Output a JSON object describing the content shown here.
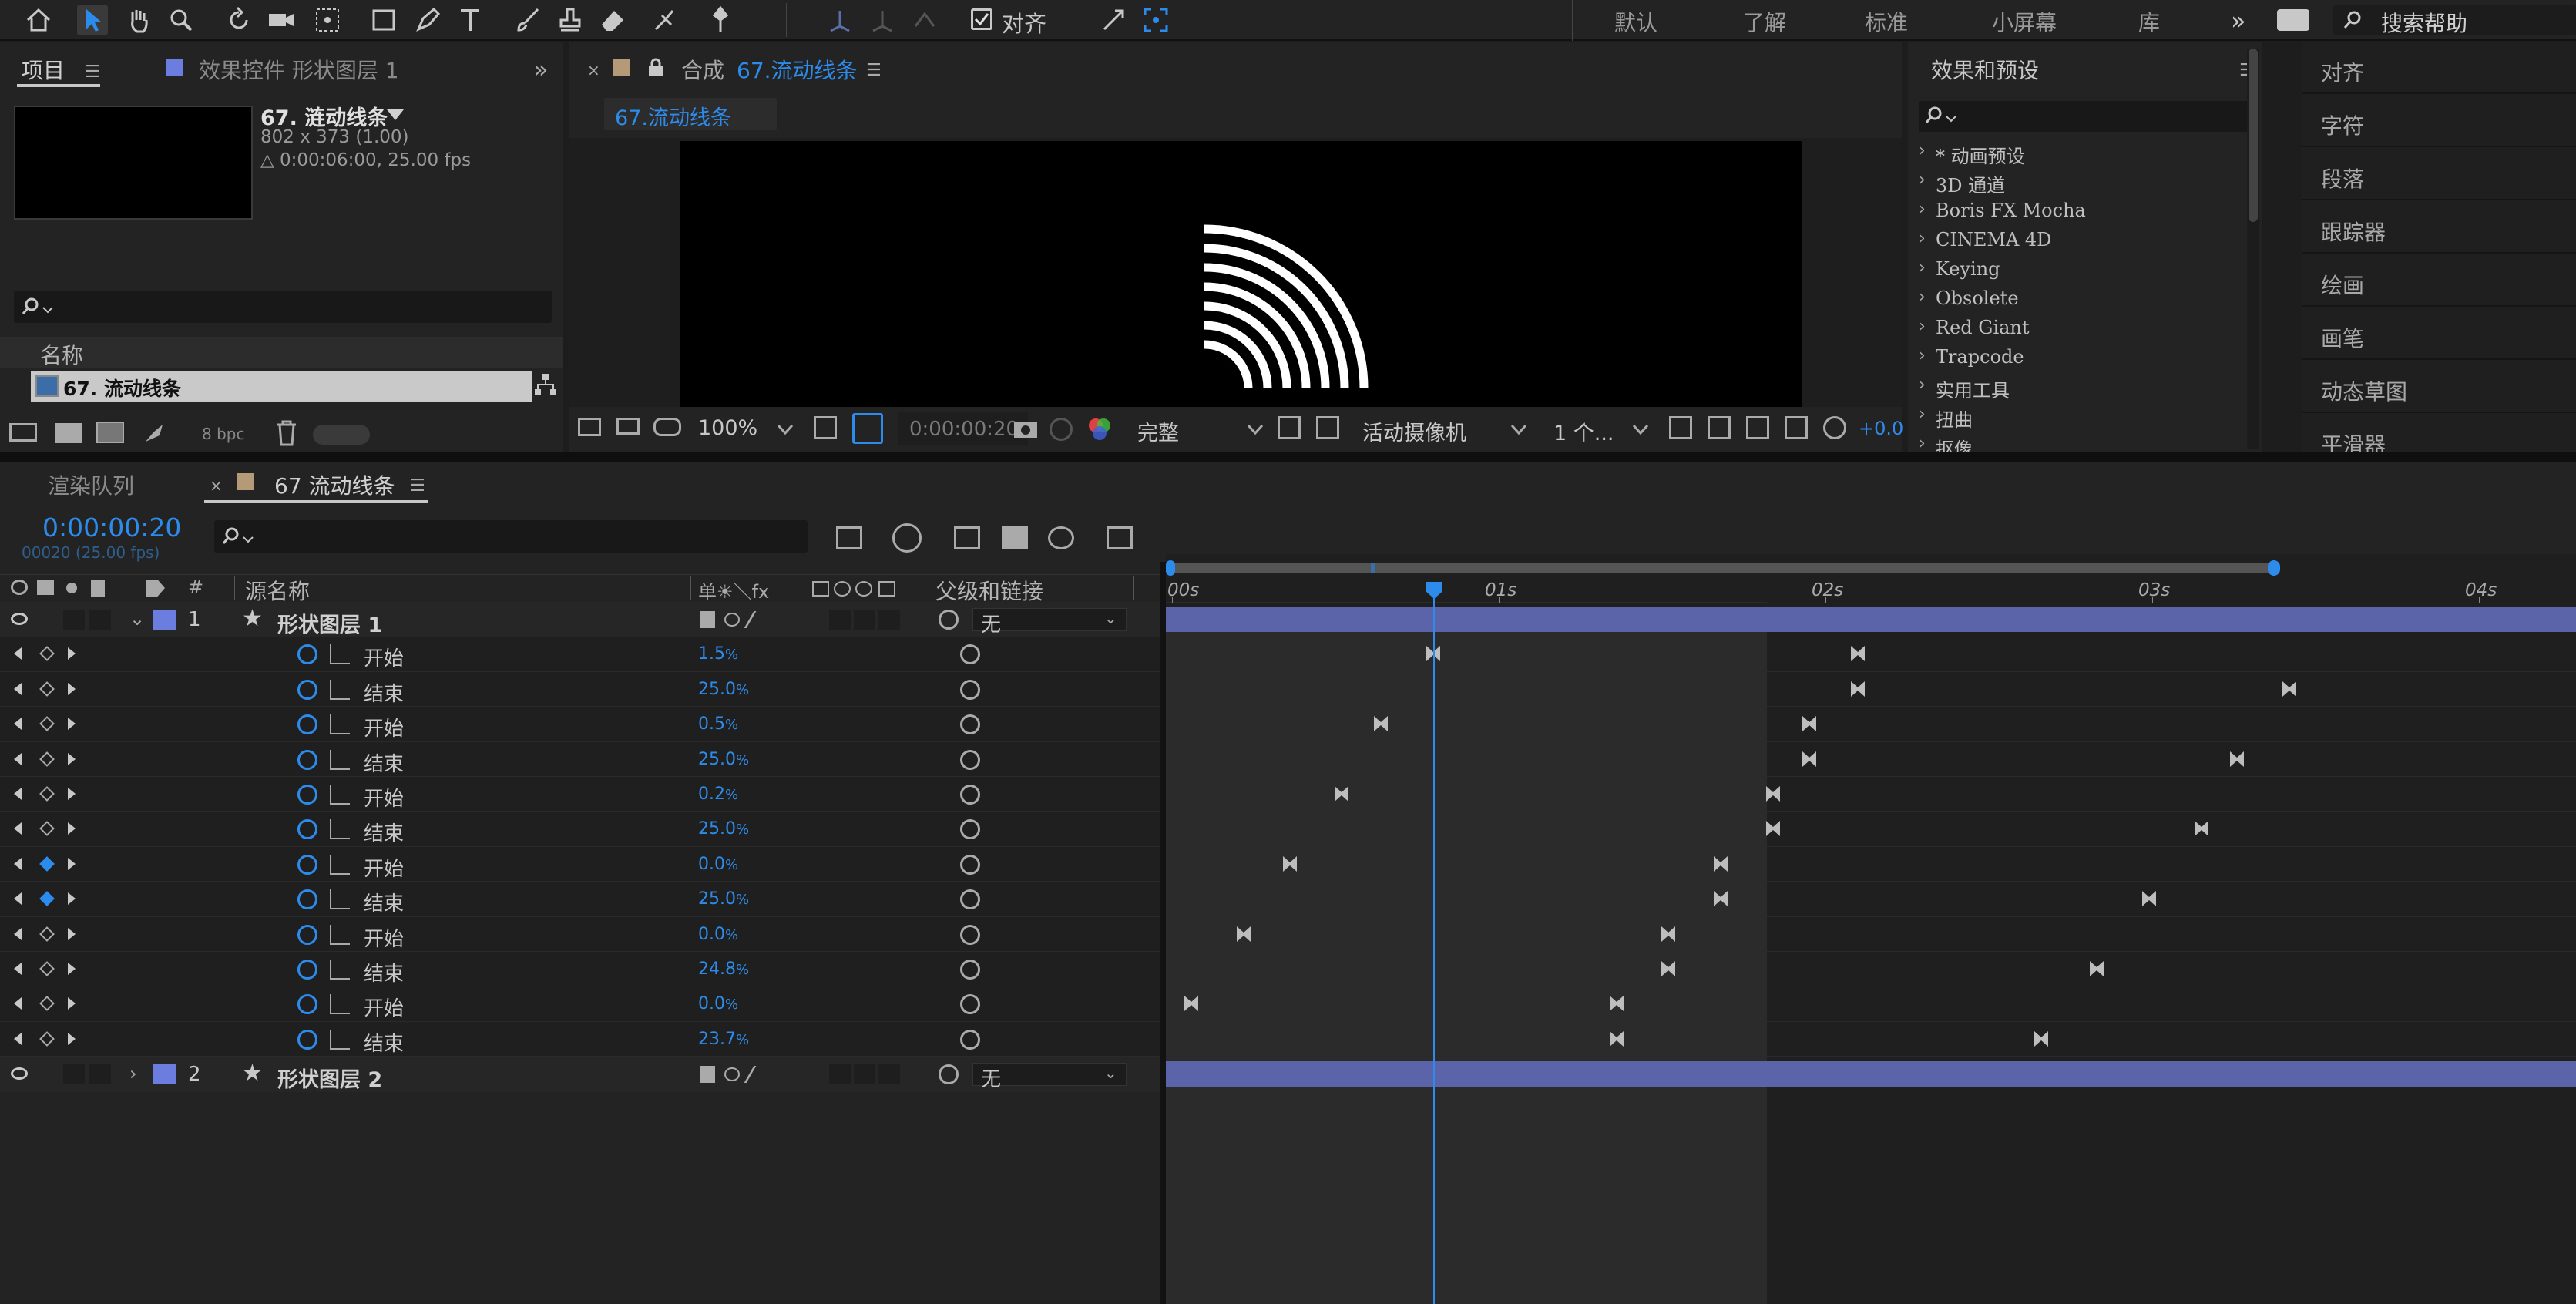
{
  "toolbar": {
    "align_label": "对齐",
    "workspaces": [
      "默认",
      "了解",
      "标准",
      "小屏幕",
      "库"
    ],
    "search_help": "搜索帮助"
  },
  "project_panel": {
    "tab_label": "项目",
    "effect_controls_label": "效果控件 形状图层 1",
    "comp_name": "67. 涟动线条",
    "comp_dims": "802 x 373 (1.00)",
    "comp_duration": "△ 0:00:06:00, 25.00 fps",
    "column_name": "名称",
    "item_name": "67. 流动线条",
    "bpc": "8 bpc"
  },
  "comp_panel": {
    "tab_prefix": "合成",
    "tab_name": "67.流动线条",
    "sub_tab": "67.流动线条",
    "zoom": "100%",
    "timecode": "0:00:00:20",
    "resolution": "完整",
    "camera": "活动摄像机",
    "views": "1 个...",
    "exposure": "+0.0"
  },
  "effects_panel": {
    "title": "效果和预设",
    "items": [
      "* 动画预设",
      "3D 通道",
      "Boris FX Mocha",
      "CINEMA 4D",
      "Keying",
      "Obsolete",
      "Red Giant",
      "Trapcode",
      "实用工具",
      "扭曲",
      "抠像"
    ]
  },
  "right_panel": {
    "items": [
      "对齐",
      "字符",
      "段落",
      "跟踪器",
      "绘画",
      "画笔",
      "动态草图",
      "平滑器"
    ]
  },
  "timeline": {
    "render_queue_tab": "渲染队列",
    "comp_tab": "67 流动线条",
    "timecode": "0:00:00:20",
    "frame_info": "00020 (25.00 fps)",
    "col_hash": "#",
    "col_source": "源名称",
    "col_switches": "单☀＼fx",
    "col_parent": "父级和链接",
    "ruler": [
      "00s",
      "01s",
      "02s",
      "03s",
      "04s"
    ],
    "layers": [
      {
        "num": "1",
        "name": "形状图层 1",
        "parent": "无"
      },
      {
        "num": "2",
        "name": "形状图层 2",
        "parent": "无"
      }
    ],
    "props": [
      {
        "name": "开始",
        "value": "1.5",
        "unit": "%",
        "kf": [
          0.8,
          2.1
        ]
      },
      {
        "name": "结束",
        "value": "25.0",
        "unit": "%",
        "kf": [
          2.1,
          3.42
        ]
      },
      {
        "name": "开始",
        "value": "0.5",
        "unit": "%",
        "kf": [
          0.64,
          1.95
        ]
      },
      {
        "name": "结束",
        "value": "25.0",
        "unit": "%",
        "kf": [
          1.95,
          3.26
        ]
      },
      {
        "name": "开始",
        "value": "0.2",
        "unit": "%",
        "kf": [
          0.52,
          1.84
        ]
      },
      {
        "name": "结束",
        "value": "25.0",
        "unit": "%",
        "kf": [
          1.84,
          3.15
        ]
      },
      {
        "name": "开始",
        "value": "0.0",
        "unit": "%",
        "kf": [
          0.36,
          1.68
        ]
      },
      {
        "name": "结束",
        "value": "25.0",
        "unit": "%",
        "kf": [
          1.68,
          2.99
        ]
      },
      {
        "name": "开始",
        "value": "0.0",
        "unit": "%",
        "kf": [
          0.22,
          1.52
        ]
      },
      {
        "name": "结束",
        "value": "24.8",
        "unit": "%",
        "kf": [
          1.52,
          2.83
        ]
      },
      {
        "name": "开始",
        "value": "0.0",
        "unit": "%",
        "kf": [
          0.06,
          1.36
        ]
      },
      {
        "name": "结束",
        "value": "23.7",
        "unit": "%",
        "kf": [
          1.36,
          2.66
        ]
      }
    ],
    "work_area_end_seconds": 1.82,
    "current_time_seconds": 0.8,
    "colors": {
      "accent": "#2d8ceb",
      "layer_bar": "#5b64a8",
      "layer_label": "#6b7ee0"
    }
  }
}
